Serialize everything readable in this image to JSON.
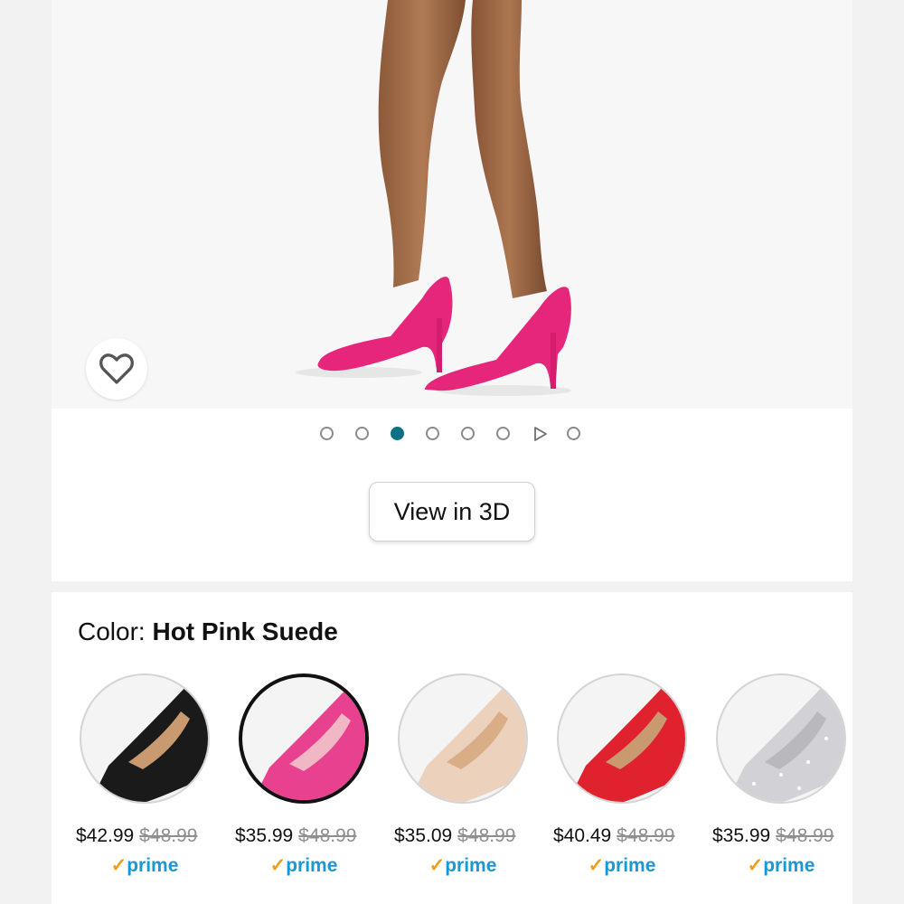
{
  "gallery": {
    "image_alt": "Model wearing hot pink suede pointed-toe stiletto pumps",
    "dot_count": 8,
    "active_dot_index": 2,
    "video_dot_index": 6
  },
  "favorite": {
    "icon": "heart-outline-icon"
  },
  "view3d": {
    "label": "View in 3D"
  },
  "color": {
    "label_prefix": "Color: ",
    "selected_name": "Hot Pink Suede"
  },
  "swatches": [
    {
      "color": "#1a1a1a",
      "price": "$42.99",
      "list_price": "$48.99",
      "prime_check": "✓",
      "prime_text": "prime",
      "selected": false
    },
    {
      "color": "#e8418f",
      "price": "$35.99",
      "list_price": "$48.99",
      "prime_check": "✓",
      "prime_text": "prime",
      "selected": true
    },
    {
      "color": "#ecd2bc",
      "price": "$35.09",
      "list_price": "$48.99",
      "prime_check": "✓",
      "prime_text": "prime",
      "selected": false
    },
    {
      "color": "#e0222e",
      "price": "$40.49",
      "list_price": "$48.99",
      "prime_check": "✓",
      "prime_text": "prime",
      "selected": false
    },
    {
      "color": "#d2d2d6",
      "price": "$35.99",
      "list_price": "$48.99",
      "prime_check": "✓",
      "prime_text": "prime",
      "selected": false
    }
  ],
  "colors": {
    "accent_teal": "#0b7285",
    "prime_blue": "#1a98d5",
    "prime_check": "#f39c12"
  }
}
